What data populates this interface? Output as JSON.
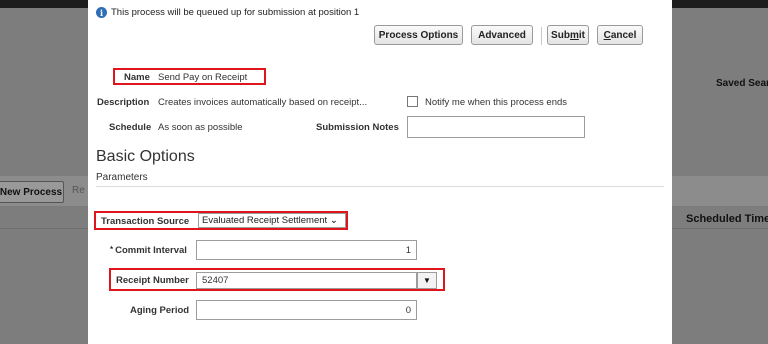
{
  "background": {
    "new_process_label": "New Process",
    "truncated_button_label": "Re",
    "saved_search_label": "Saved Sear",
    "scheduled_time_label": "Scheduled Time"
  },
  "dialog": {
    "info_message": "This process will be queued up for submission at position 1",
    "buttons": {
      "process_options": "Process Options",
      "advanced": "Advanced",
      "submit_prefix": "Sub",
      "submit_mnemonic": "m",
      "submit_suffix": "it",
      "cancel_mnemonic": "C",
      "cancel_suffix": "ancel"
    },
    "fields": {
      "name_label": "Name",
      "name_value": "Send Pay on Receipt",
      "description_label": "Description",
      "description_value": "Creates invoices automatically based on receipt...",
      "notify_label": "Notify me when this process ends",
      "schedule_label": "Schedule",
      "schedule_value": "As soon as possible",
      "submission_notes_label": "Submission Notes",
      "submission_notes_value": ""
    },
    "basic_options_title": "Basic Options",
    "parameters_label": "Parameters",
    "parameters": {
      "transaction_source_label": "Transaction Source",
      "transaction_source_value": "Evaluated Receipt Settlement",
      "commit_interval_required_mark": "*",
      "commit_interval_label": "Commit Interval",
      "commit_interval_value": "1",
      "receipt_number_label": "Receipt Number",
      "receipt_number_value": "52407",
      "aging_period_label": "Aging Period",
      "aging_period_value": "0"
    }
  },
  "colors": {
    "highlight": "#e0141b",
    "info_icon": "#2f6db5",
    "overlay": "#7d7d7d"
  },
  "icons": {
    "info": "info-icon",
    "select_chevron": "chevron-down-icon",
    "combo_dropdown": "triangle-down-icon"
  }
}
